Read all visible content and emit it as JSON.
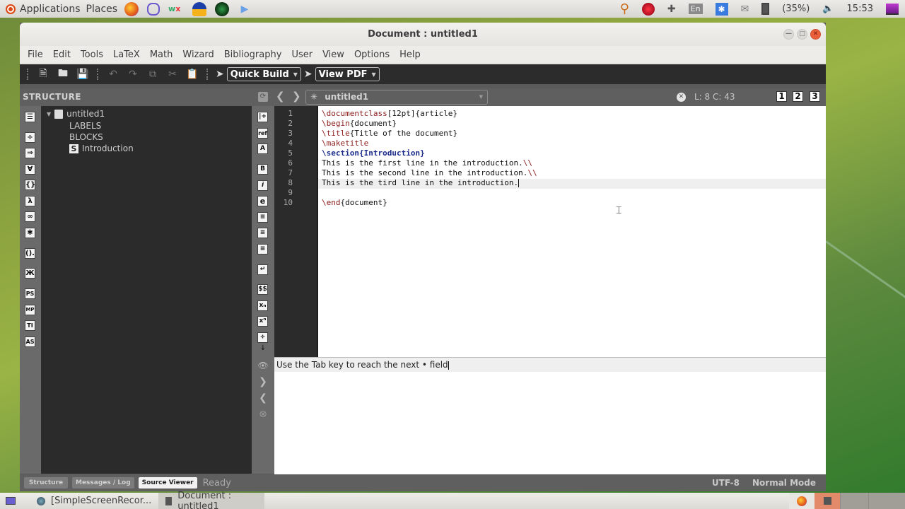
{
  "top_panel": {
    "menus": [
      "Applications",
      "Places"
    ],
    "launchers": [
      "firefox-icon",
      "network-graph-icon",
      "wx-icon",
      "headphones-icon",
      "globe-icon",
      "media-icon"
    ],
    "tray": {
      "battery": "(35%)",
      "time": "15:53",
      "keyboard_layout": "En"
    }
  },
  "window": {
    "title": "Document : untitled1",
    "menu": [
      "File",
      "Edit",
      "Tools",
      "LaTeX",
      "Math",
      "Wizard",
      "Bibliography",
      "User",
      "View",
      "Options",
      "Help"
    ],
    "menu_mnemonics": [
      "F",
      "E",
      "T",
      "L",
      "M",
      "W",
      "B",
      "U",
      "V",
      "O",
      "H"
    ],
    "toolbar": {
      "quick_build": "Quick Build",
      "view_pdf": "View PDF"
    },
    "structure": {
      "title": "STRUCTURE",
      "tree": {
        "root": "untitled1",
        "children": [
          "LABELS",
          "BLOCKS"
        ],
        "section_badge": "S",
        "section": "Introduction"
      }
    },
    "left_icons": [
      "☰",
      "÷",
      "⇒",
      "∀",
      "{}",
      "λ",
      "∞",
      "✱",
      "().",
      "Ж",
      "PS",
      "MP",
      "TI",
      "AS"
    ],
    "mid_icons": [
      "|+",
      "ref",
      "A",
      "B",
      "i",
      "e",
      "≡",
      "≡",
      "≡",
      "↵",
      "$$",
      "xₙ",
      "xⁿ",
      "÷"
    ],
    "editor": {
      "document_select": "untitled1",
      "cursor_position": "L: 8 C: 43",
      "view_buttons": [
        "1",
        "2",
        "3"
      ],
      "line_numbers": [
        "1",
        "2",
        "3",
        "4",
        "5",
        "6",
        "7",
        "8",
        "9",
        "10"
      ],
      "lines": [
        {
          "cmd": "\\documentclass",
          "rest": "[12pt]{article}"
        },
        {
          "cmd": "\\begin",
          "rest": "{document}"
        },
        {
          "cmd": "\\title",
          "rest": "{Title of the document}"
        },
        {
          "cmd": "\\maketitle",
          "rest": ""
        },
        {
          "section": "\\section{Introduction}"
        },
        {
          "text": "This is the first line in the introduction.",
          "tail": "\\\\"
        },
        {
          "text": "This is the second line in the introduction.",
          "tail": "\\\\"
        },
        {
          "text": "This is the tird line in the introduction.",
          "tail": ""
        },
        {
          "text": ""
        },
        {
          "cmd": "\\end",
          "rest": "{document}"
        }
      ]
    },
    "message": "Use the Tab key to reach the next • field",
    "statusbar": {
      "tabs": [
        "Structure",
        "Messages / Log",
        "Source Viewer"
      ],
      "status": "Ready",
      "encoding": "UTF-8",
      "mode": "Normal Mode"
    }
  },
  "taskbar": {
    "tasks": [
      "[SimpleScreenRecor...",
      "Document : untitled1"
    ]
  },
  "colors": {
    "accent_close": "#e9603b",
    "section_blue": "#1a2a8b",
    "command_red": "#8b1a1a"
  }
}
